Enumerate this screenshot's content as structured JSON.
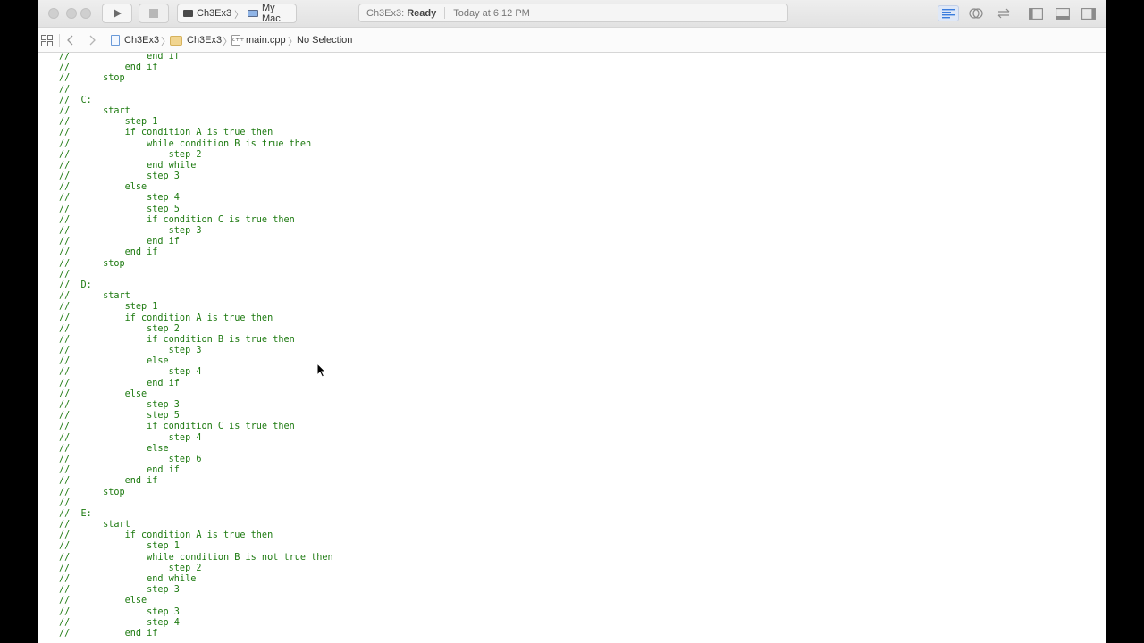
{
  "toolbar": {
    "scheme_target": "Ch3Ex3",
    "scheme_device": "My Mac",
    "activity_project": "Ch3Ex3:",
    "activity_status": "Ready",
    "activity_time": "Today at 6:12 PM"
  },
  "jumpbar": {
    "project": "Ch3Ex3",
    "group": "Ch3Ex3",
    "file": "main.cpp",
    "selection": "No Selection",
    "file_icon_text": "c++"
  },
  "colors": {
    "comment": "#1d7a10",
    "toolbar_bg": "#e8e8e8",
    "accent": "#3b7ddd"
  },
  "icons": {
    "run": "play-icon",
    "stop": "stop-icon",
    "nav": "grid-icon",
    "back": "chevron-left-icon",
    "forward": "chevron-right-icon"
  },
  "code": {
    "lines": [
      "//              end if",
      "//          end if",
      "//      stop",
      "//",
      "//  C:",
      "//      start",
      "//          step 1",
      "//          if condition A is true then",
      "//              while condition B is true then",
      "//                  step 2",
      "//              end while",
      "//              step 3",
      "//          else",
      "//              step 4",
      "//              step 5",
      "//              if condition C is true then",
      "//                  step 3",
      "//              end if",
      "//          end if",
      "//      stop",
      "//",
      "//  D:",
      "//      start",
      "//          step 1",
      "//          if condition A is true then",
      "//              step 2",
      "//              if condition B is true then",
      "//                  step 3",
      "//              else",
      "//                  step 4",
      "//              end if",
      "//          else",
      "//              step 3",
      "//              step 5",
      "//              if condition C is true then",
      "//                  step 4",
      "//              else",
      "//                  step 6",
      "//              end if",
      "//          end if",
      "//      stop",
      "//",
      "//  E:",
      "//      start",
      "//          if condition A is true then",
      "//              step 1",
      "//              while condition B is not true then",
      "//                  step 2",
      "//              end while",
      "//              step 3",
      "//          else",
      "//              step 3",
      "//              step 4",
      "//          end if"
    ]
  }
}
